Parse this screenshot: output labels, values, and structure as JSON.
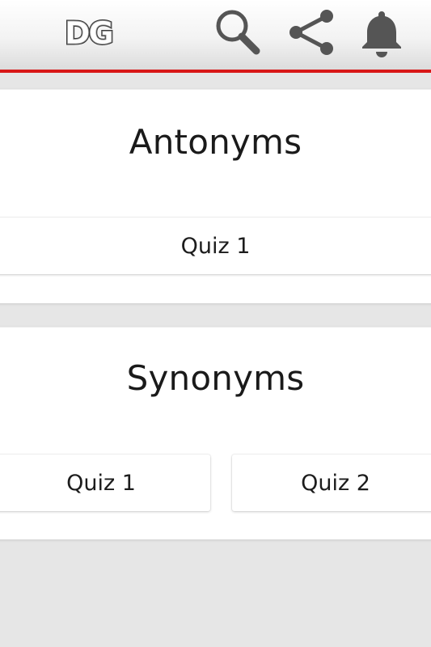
{
  "app_bar": {
    "logo_text": "DG",
    "accent_color": "#d81818",
    "icons": [
      "search-icon",
      "share-icon",
      "bell-icon"
    ]
  },
  "sections": [
    {
      "title": "Antonyms",
      "quizzes": [
        "Quiz 1"
      ]
    },
    {
      "title": "Synonyms",
      "quizzes": [
        "Quiz 1",
        "Quiz 2"
      ]
    }
  ]
}
